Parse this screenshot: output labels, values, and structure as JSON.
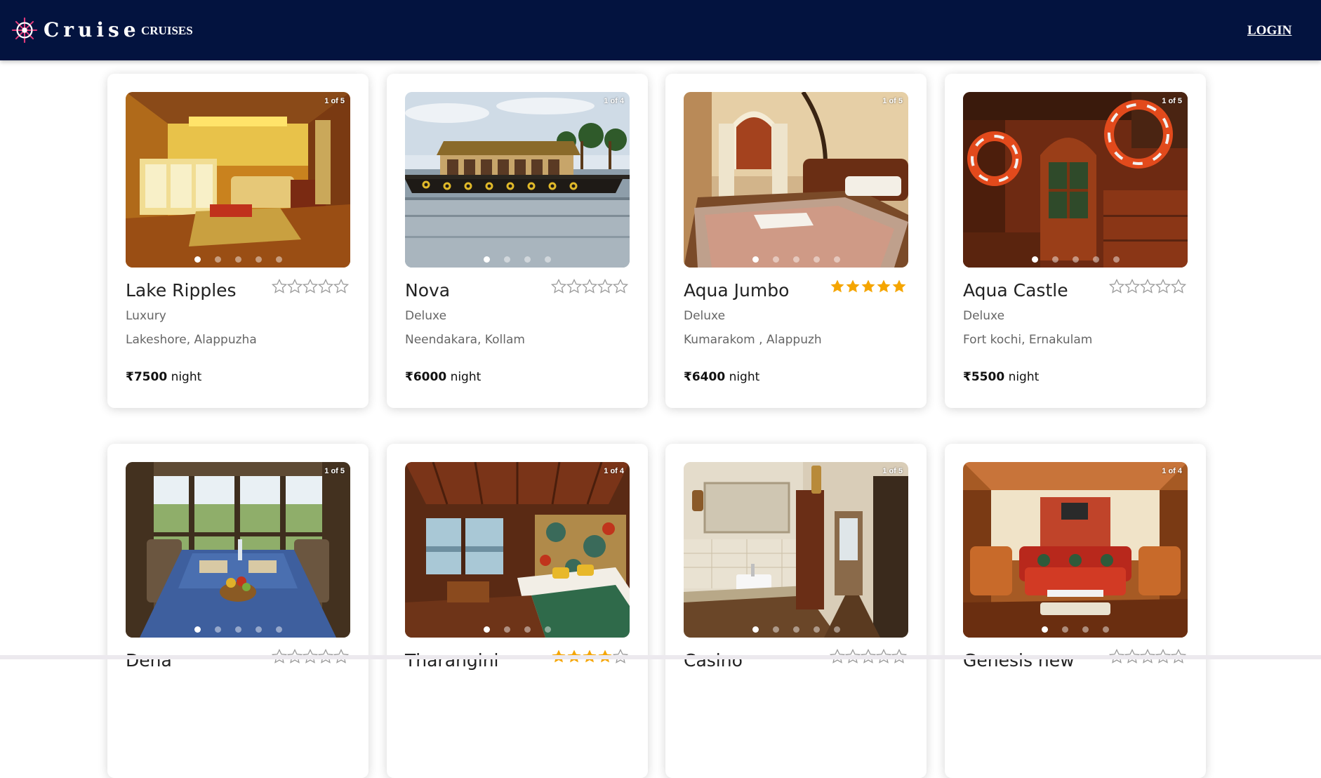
{
  "nav": {
    "brand": "Cruise",
    "logo_icon": "ship-wheel-icon",
    "cruises_label": "CRUISES",
    "login_label": "LOGIN",
    "background": "#03133f"
  },
  "colors": {
    "star_filled": "#f5a500",
    "star_empty": "#9a9a9a"
  },
  "cards": [
    {
      "name": "Lake Ripples",
      "category": "Luxury",
      "location": "Lakeshore, Alappuzha",
      "price": "₹7500",
      "unit": "night",
      "rating": 0,
      "counter": "1 of 5",
      "photo_count": 5,
      "photo_index": 1,
      "photo": "luxury-living-room"
    },
    {
      "name": "Nova",
      "category": "Deluxe",
      "location": "Neendakara, Kollam",
      "price": "₹6000",
      "unit": "night",
      "rating": 0,
      "counter": "1 of 4",
      "photo_count": 4,
      "photo_index": 1,
      "photo": "houseboat-on-water"
    },
    {
      "name": "Aqua Jumbo",
      "category": "Deluxe",
      "location": "Kumarakom , Alappuzh",
      "price": "₹6400",
      "unit": "night",
      "rating": 5,
      "counter": "1 of 5",
      "photo_count": 5,
      "photo_index": 1,
      "photo": "bedroom"
    },
    {
      "name": "Aqua Castle",
      "category": "Deluxe",
      "location": "Fort kochi, Ernakulam",
      "price": "₹5500",
      "unit": "night",
      "rating": 0,
      "counter": "1 of 5",
      "photo_count": 5,
      "photo_index": 1,
      "photo": "wooden-interior-lifebuoys"
    },
    {
      "name": "Dena",
      "category": "",
      "location": "",
      "price": "",
      "unit": "",
      "rating": 0,
      "counter": "1 of 5",
      "photo_count": 5,
      "photo_index": 1,
      "photo": "dining-table"
    },
    {
      "name": "Tharangini",
      "category": "",
      "location": "",
      "price": "",
      "unit": "",
      "rating": 4,
      "counter": "1 of 4",
      "photo_count": 4,
      "photo_index": 1,
      "photo": "wooden-bedroom"
    },
    {
      "name": "Casino",
      "category": "",
      "location": "",
      "price": "",
      "unit": "",
      "rating": 0,
      "counter": "1 of 5",
      "photo_count": 5,
      "photo_index": 1,
      "photo": "bathroom-vanity"
    },
    {
      "name": "Genesis new",
      "category": "",
      "location": "",
      "price": "",
      "unit": "",
      "rating": 0,
      "counter": "1 of 4",
      "photo_count": 4,
      "photo_index": 1,
      "photo": "lounge-sofa"
    }
  ]
}
